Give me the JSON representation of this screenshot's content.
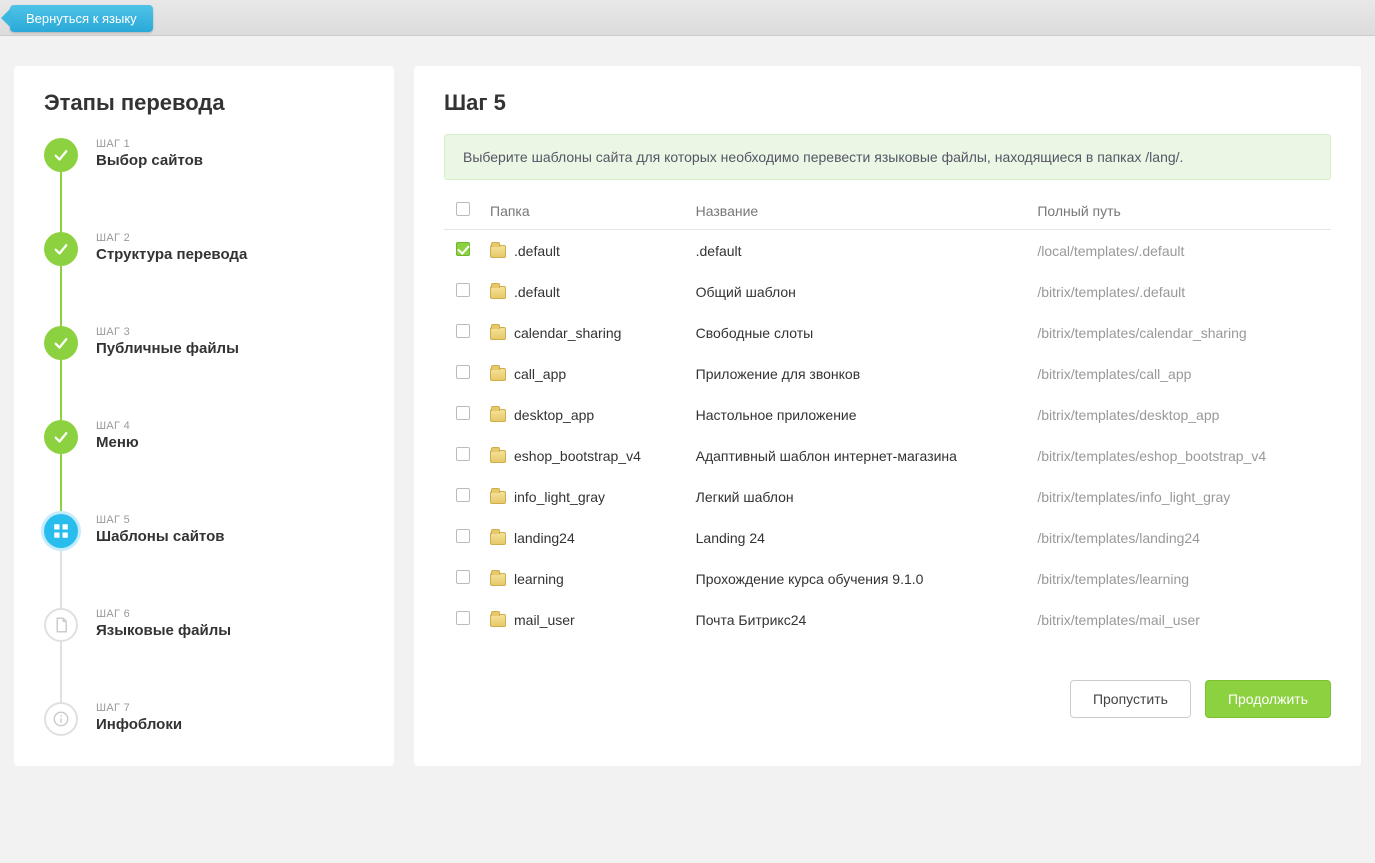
{
  "topbar": {
    "back_label": "Вернуться к языку"
  },
  "sidebar": {
    "title": "Этапы перевода",
    "steps": [
      {
        "num": "ШАГ 1",
        "label": "Выбор сайтов",
        "status": "done"
      },
      {
        "num": "ШАГ 2",
        "label": "Структура перевода",
        "status": "done"
      },
      {
        "num": "ШАГ 3",
        "label": "Публичные файлы",
        "status": "done"
      },
      {
        "num": "ШАГ 4",
        "label": "Меню",
        "status": "done"
      },
      {
        "num": "ШАГ 5",
        "label": "Шаблоны сайтов",
        "status": "current"
      },
      {
        "num": "ШАГ 6",
        "label": "Языковые файлы",
        "status": "pending"
      },
      {
        "num": "ШАГ 7",
        "label": "Инфоблоки",
        "status": "pending"
      }
    ]
  },
  "main": {
    "title": "Шаг 5",
    "hint": "Выберите шаблоны сайта для которых необходимо перевести языковые файлы, находящиеся в папках /lang/.",
    "columns": {
      "folder": "Папка",
      "name": "Название",
      "path": "Полный путь"
    },
    "rows": [
      {
        "checked": true,
        "folder": ".default",
        "name": ".default",
        "path": "/local/templates/.default"
      },
      {
        "checked": false,
        "folder": ".default",
        "name": "Общий шаблон",
        "path": "/bitrix/templates/.default"
      },
      {
        "checked": false,
        "folder": "calendar_sharing",
        "name": "Свободные слоты",
        "path": "/bitrix/templates/calendar_sharing"
      },
      {
        "checked": false,
        "folder": "call_app",
        "name": "Приложение для звонков",
        "path": "/bitrix/templates/call_app"
      },
      {
        "checked": false,
        "folder": "desktop_app",
        "name": "Настольное приложение",
        "path": "/bitrix/templates/desktop_app"
      },
      {
        "checked": false,
        "folder": "eshop_bootstrap_v4",
        "name": "Адаптивный шаблон интернет-магазина",
        "path": "/bitrix/templates/eshop_bootstrap_v4"
      },
      {
        "checked": false,
        "folder": "info_light_gray",
        "name": "Легкий шаблон",
        "path": "/bitrix/templates/info_light_gray"
      },
      {
        "checked": false,
        "folder": "landing24",
        "name": "Landing 24",
        "path": "/bitrix/templates/landing24"
      },
      {
        "checked": false,
        "folder": "learning",
        "name": "Прохождение курса обучения 9.1.0",
        "path": "/bitrix/templates/learning"
      },
      {
        "checked": false,
        "folder": "mail_user",
        "name": "Почта Битрикс24",
        "path": "/bitrix/templates/mail_user"
      }
    ],
    "actions": {
      "skip": "Пропустить",
      "continue": "Продолжить"
    }
  }
}
